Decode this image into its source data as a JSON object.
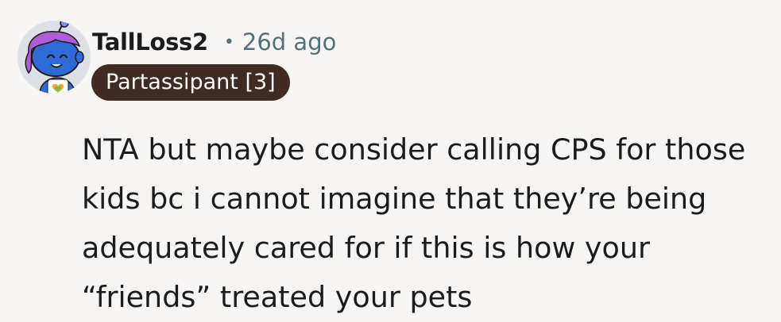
{
  "comment": {
    "username": "TallLoss2",
    "separator": "•",
    "timestamp": "26d ago",
    "flair": "Partassipant [3]",
    "body_lines": [
      "NTA but maybe consider calling CPS for those",
      "kids bc i cannot imagine that they’re being",
      "adequately cared for if this is how your",
      "“friends” treated your pets"
    ]
  },
  "colors": {
    "background": "#f6f5f4",
    "flair_bg": "#3f2a24",
    "muted_text": "#576f76",
    "avatar_skin": "#2e6bd6",
    "avatar_hair": "#b15cd8"
  },
  "icons": {
    "avatar": "snoo-avatar-icon"
  }
}
